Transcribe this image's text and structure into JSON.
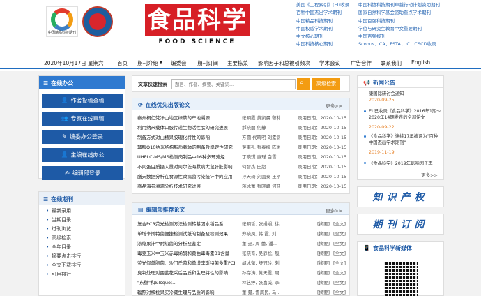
{
  "header": {
    "brand_zh": "食品科学",
    "brand_en": "FOOD SCIENCE",
    "logo1_caption": "中国精品科技期刊",
    "links_col1": [
      "美国《工程索引》(EI)收录",
      "百种中国杰出学术期刊",
      "中国精品科技期刊",
      "中国权威学术期刊",
      "中文核心期刊",
      "中国科技核心期刊"
    ],
    "links_col2": [
      "中国科协科技期刊卓越行动计划资助期刊",
      "国家自然科学基金资助重点学术期刊",
      "中国百强科技期刊",
      "学位与研究生教育中文重要期刊",
      "中国百强报刊",
      "Scopus、CA、FSTA、IC、CSCD收录"
    ]
  },
  "nav": {
    "date": "2020年10月17日 星期六",
    "items": [
      "首页",
      "期刊介绍",
      "编委会",
      "期刊订阅",
      "主要栋菜",
      "影响因子和总被引频次",
      "学术会议",
      "广告合作",
      "联系我们",
      "English"
    ]
  },
  "office": {
    "title": "在线办公",
    "buttons": [
      "作者投稿查稿",
      "专家在线审稿",
      "编委办公登录",
      "主编在线办公",
      "编辑部登录"
    ]
  },
  "browse": {
    "title": "在线期刊",
    "items": [
      "最新录用",
      "当期目录",
      "过刊浏览",
      "高级检索",
      "全年目录",
      "摘要点击排行",
      "全文下载排行",
      "引用排行"
    ]
  },
  "search": {
    "label": "文章快速检索",
    "placeholder": "题目、作者、摘要、关键词...",
    "adv_label": "高级检索"
  },
  "priority": {
    "title": "在线优先出版论文",
    "more": "更多>>",
    "rows": [
      {
        "title": "泰州桐仁梵净山地区绿茶的产地溯源",
        "authors": "张明霞 黄凯晨 黎礼",
        "date": "录用日期：2020-10-15"
      },
      {
        "title": "利用纳米载体口服传递生物活性肽的研究进展",
        "authors": "郝晓丽 何静",
        "date": "录用日期：2020-10-15"
      },
      {
        "title": "制备方式对山楂果胶理化特性的影响",
        "authors": "方圆 代晓明 刘素锦",
        "date": "录用日期：2020-10-15"
      },
      {
        "title": "辅酶Q10纳米结构脂质载体的制备及稳定性研究",
        "authors": "芽甫礼 张春梅 陈彬",
        "date": "录用日期：2020-10-15"
      },
      {
        "title": "UHPLC-MS/MS检测肉制品中16种多环芳烃",
        "authors": "丁晓琪 惠瑾 白雪",
        "date": "录用日期：2020-10-15"
      },
      {
        "title": "不同蛋白质摄入量对阿尔茨海默病大鼠肝脏影响",
        "authors": "何智杰 田超",
        "date": "录用日期：2020-10-15"
      },
      {
        "title": "膳天数据分析在食源性致病菌污染统计中的应用",
        "authors": "孙天琦 刘国泰 王明",
        "date": "录用日期：2020-10-15"
      },
      {
        "title": "商品海参溯源分析技术研究进展",
        "authors": "蒋冰蕾 张晓峰 何晓",
        "date": "录用日期：2020-10-15"
      }
    ]
  },
  "recommend": {
    "title": "编辑部推荐论文",
    "more": "更多>>",
    "rows": [
      {
        "title": "复合PCR荧光检测方法检测转基因水稻品系",
        "authors": "张明哲, 张娟娟, 徐..."
      },
      {
        "title": "单增李斯特菌便捷检测试纸的制备及检测效果",
        "authors": "郑晓凤, 韩 霞, 刘..."
      },
      {
        "title": "浓缩果汁中耐热菌的分析及鉴定",
        "authors": "董 迅, 周 蕾, 潘..."
      },
      {
        "title": "霉变玉米中玉米赤霉烯酮和黄曲霉毒素B1含量",
        "authors": "张晓奇, 吴静松, 殷..."
      },
      {
        "title": "荧光假单胞菌、沙门氏菌和单增李斯特菌多重PCR",
        "authors": "胡冰蕾, 舒冠玲, 刘..."
      },
      {
        "title": "臭氧处理对西蓝花采后品质和生理特性的影响",
        "authors": "孙存涛, 黄天霞, 周..."
      },
      {
        "title": "\"东壁\"和&lsquo;...",
        "authors": "林艺婷, 张嘉威, 李..."
      },
      {
        "title": "辐照对核桃果实冷藏生理与品质的影响",
        "authors": "董 楚, 鲁周民, 马..."
      }
    ],
    "tag_abs": "[摘要]",
    "tag_full": "[全文]"
  },
  "notice": {
    "title": "新闻公告",
    "items": [
      {
        "text": "康国际研讨会通知",
        "date": "2020-09-25"
      },
      {
        "text": "EI 已收录《食品科学》2016年1期～2020年14期发表的全部论文",
        "date": "2020-09-22"
      },
      {
        "text": "《食品科学》连续17年被评为\"百种中国杰出学术期刊\"",
        "date": "2019-11-19"
      },
      {
        "text": "《食品科学》2019年影响因子再",
        "date": ""
      }
    ],
    "more": "更多>>"
  },
  "banners": [
    "知识产权",
    "期刊订阅"
  ],
  "media": {
    "title": "食品科学新媒体"
  }
}
